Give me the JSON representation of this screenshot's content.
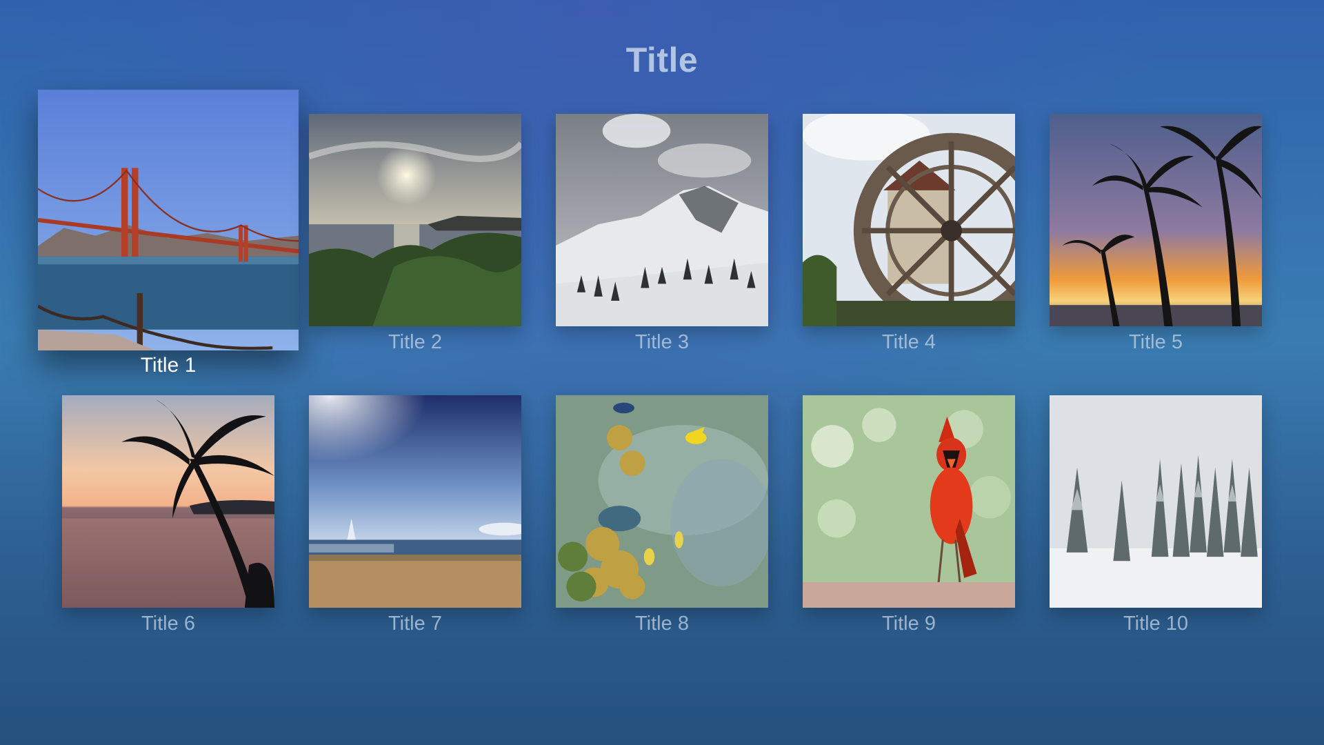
{
  "screen": {
    "title": "Title",
    "focused_index": 0
  },
  "tiles": [
    {
      "title": "Title 1",
      "image": "golden-gate-bridge-photo"
    },
    {
      "title": "Title 2",
      "image": "coastal-sunset-photo"
    },
    {
      "title": "Title 3",
      "image": "snowy-mountain-photo"
    },
    {
      "title": "Title 4",
      "image": "water-wheel-photo"
    },
    {
      "title": "Title 5",
      "image": "palm-trees-sunset-photo"
    },
    {
      "title": "Title 6",
      "image": "palm-tree-ocean-sunset-photo"
    },
    {
      "title": "Title 7",
      "image": "beach-sailboats-photo"
    },
    {
      "title": "Title 8",
      "image": "coral-reef-fish-photo"
    },
    {
      "title": "Title 9",
      "image": "red-cardinal-photo"
    },
    {
      "title": "Title 10",
      "image": "snowy-forest-photo"
    }
  ]
}
